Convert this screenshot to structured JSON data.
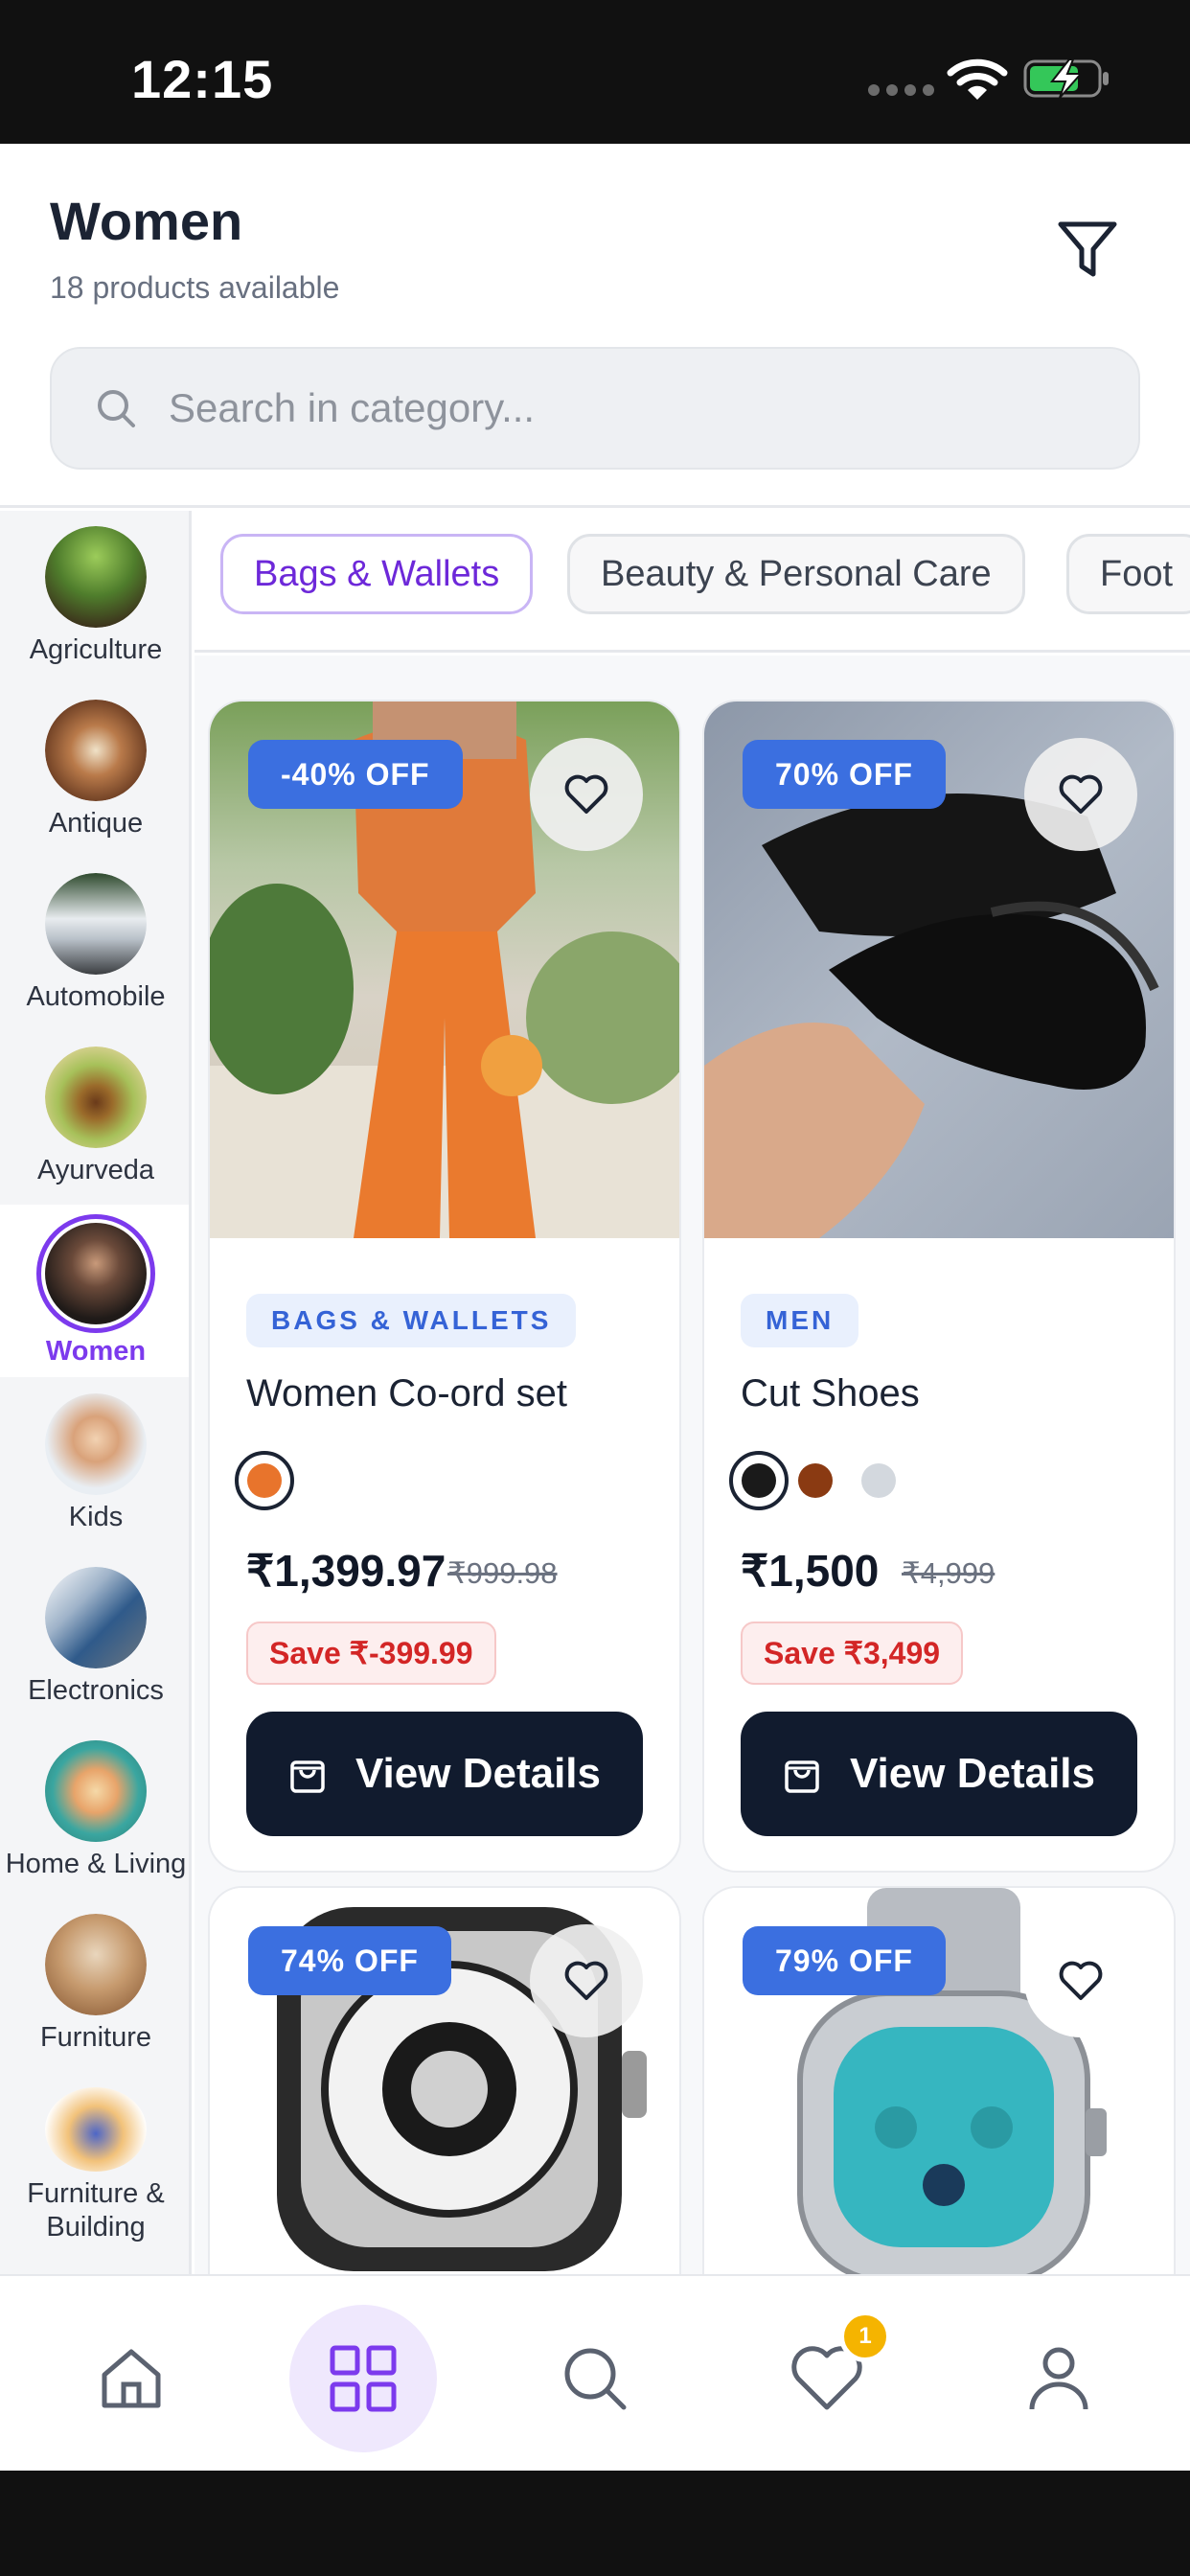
{
  "status_bar": {
    "time": "12:15"
  },
  "header": {
    "title": "Women",
    "subtitle": "18 products available"
  },
  "search": {
    "placeholder": "Search in category..."
  },
  "sidebar": {
    "items": [
      {
        "label": "Agriculture",
        "icon": "agriculture-thumb",
        "color": "#5d8a3a"
      },
      {
        "label": "Antique",
        "icon": "antique-thumb",
        "color": "#8a5a3c"
      },
      {
        "label": "Automobile",
        "icon": "automobile-thumb",
        "color": "#9aa3ad"
      },
      {
        "label": "Ayurveda",
        "icon": "ayurveda-thumb",
        "color": "#8aa64a"
      },
      {
        "label": "Women",
        "icon": "women-thumb",
        "color": "#4a3a34",
        "active": true
      },
      {
        "label": "Kids",
        "icon": "kids-thumb",
        "color": "#c9d7e6"
      },
      {
        "label": "Electronics",
        "icon": "electronics-thumb",
        "color": "#6b8fb5"
      },
      {
        "label": "Home & Living",
        "icon": "home-living-thumb",
        "color": "#3aa6a0"
      },
      {
        "label": "Furniture",
        "icon": "furniture-thumb",
        "color": "#b88a62"
      },
      {
        "label": "Furniture & Building",
        "icon": "furniture-building-thumb",
        "color": "#4d66c7"
      }
    ]
  },
  "chips": [
    {
      "label": "Bags & Wallets",
      "active": true
    },
    {
      "label": "Beauty & Personal Care",
      "active": false
    },
    {
      "label": "Foot",
      "active": false
    }
  ],
  "products": [
    {
      "discount": "-40% OFF",
      "category": "BAGS & WALLETS",
      "name": "Women Co-ord set",
      "price": "₹1,399.97",
      "mrp": "₹999.98",
      "save": "Save ₹-399.99",
      "button": "View Details",
      "colors": [
        "#e8742c"
      ]
    },
    {
      "discount": "70% OFF",
      "category": "MEN",
      "name": "Cut Shoes",
      "price": "₹1,500",
      "mrp": "₹4,999",
      "save": "Save ₹3,499",
      "button": "View Details",
      "colors": [
        "#1a1a1a",
        "#8a3a12",
        "#d3d8de"
      ]
    },
    {
      "discount": "74% OFF"
    },
    {
      "discount": "79% OFF"
    }
  ],
  "tab_bar": {
    "tabs": [
      "home-icon",
      "grid-icon",
      "search-icon",
      "heart-icon",
      "user-icon"
    ],
    "wishlist_count": "1"
  },
  "colors": {
    "accent": "#7c3aed",
    "badge": "#3b6fe0",
    "dark_button": "#111b2e"
  }
}
